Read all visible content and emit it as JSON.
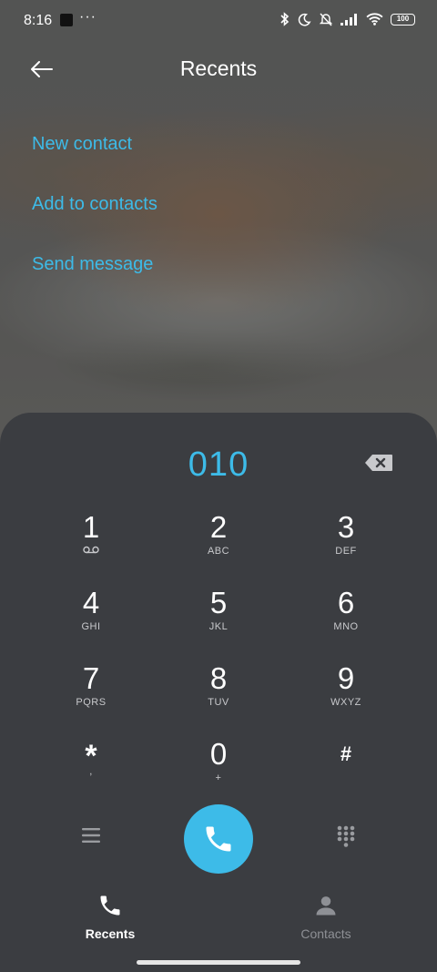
{
  "status_bar": {
    "time": "8:16",
    "more": "···",
    "battery": "100"
  },
  "header": {
    "title": "Recents",
    "back_icon": "arrow-left-icon"
  },
  "menu": {
    "items": [
      {
        "label": "New contact"
      },
      {
        "label": "Add to contacts"
      },
      {
        "label": "Send message"
      }
    ]
  },
  "dialer": {
    "number": "010",
    "keys": [
      {
        "digit": "1",
        "letters": "voicemail-icon"
      },
      {
        "digit": "2",
        "letters": "ABC"
      },
      {
        "digit": "3",
        "letters": "DEF"
      },
      {
        "digit": "4",
        "letters": "GHI"
      },
      {
        "digit": "5",
        "letters": "JKL"
      },
      {
        "digit": "6",
        "letters": "MNO"
      },
      {
        "digit": "7",
        "letters": "PQRS"
      },
      {
        "digit": "8",
        "letters": "TUV"
      },
      {
        "digit": "9",
        "letters": "WXYZ"
      },
      {
        "digit": "*",
        "letters": ","
      },
      {
        "digit": "0",
        "letters": "+"
      },
      {
        "digit": "#",
        "letters": ""
      }
    ]
  },
  "tabs": [
    {
      "label": "Recents",
      "icon": "phone-icon",
      "active": true
    },
    {
      "label": "Contacts",
      "icon": "person-icon",
      "active": false
    }
  ],
  "colors": {
    "accent": "#3dbbe8",
    "panel": "#3b3d41"
  }
}
